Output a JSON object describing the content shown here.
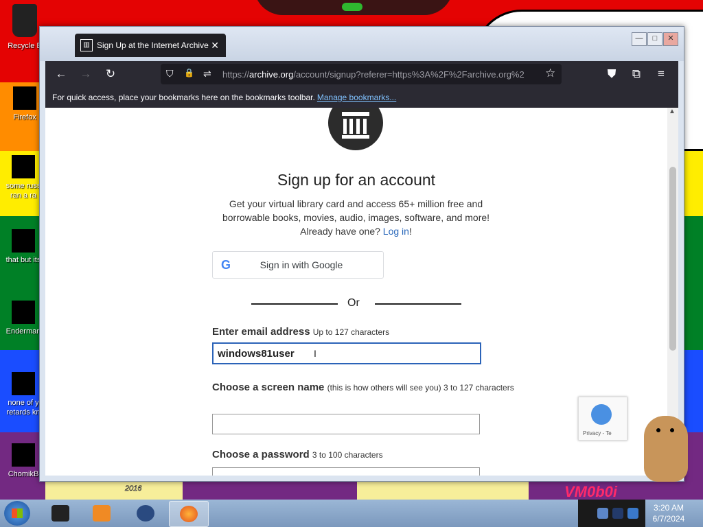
{
  "desktop": {
    "icons": [
      {
        "label": "Recycle B"
      },
      {
        "label": "Firefox"
      },
      {
        "label": "some russ ran a ra"
      },
      {
        "label": "that but its"
      },
      {
        "label": "Enderman"
      },
      {
        "label": "none of y retards kn"
      },
      {
        "label": "ChomikB"
      }
    ],
    "wallpaper_texts": {
      "tag": "2016",
      "sign": "VM0b0i"
    }
  },
  "browser": {
    "tab": {
      "title": "Sign Up at the Internet Archive",
      "close": "✕"
    },
    "url": {
      "prefix": "https://",
      "domain": "archive.org",
      "path": "/account/signup?referer=https%3A%2F%2Farchive.org%2"
    },
    "bookmarks_bar": {
      "text": "For quick access, place your bookmarks here on the bookmarks toolbar.",
      "link": "Manage bookmarks..."
    },
    "window_controls": {
      "minimize": "—",
      "maximize": "□",
      "close": "✕"
    },
    "icons": {
      "back": "←",
      "forward": "→",
      "reload": "↻",
      "shield": "⛉",
      "lock": "🔒",
      "star": "☆",
      "pocket": "⛊",
      "extensions": "⧉",
      "menu": "≡"
    }
  },
  "page": {
    "heading": "Sign up for an account",
    "intro_line1": "Get your virtual library card and access 65+ million free and borrowable books, movies, audio, images, software, and more!",
    "intro_line2": "Already have one?",
    "login_link": "Log in",
    "login_suffix": "!",
    "google_button": {
      "icon": "G",
      "label": "Sign in with Google"
    },
    "divider": "Or",
    "email": {
      "label": "Enter email address",
      "hint": "Up to 127 characters",
      "value": "windows81user"
    },
    "screen_name": {
      "label": "Choose a screen name",
      "hint": "(this is how others will see you) 3 to 127 characters",
      "value": ""
    },
    "password": {
      "label": "Choose a password",
      "hint": "3 to 100 characters",
      "value": ""
    },
    "recaptcha": {
      "text": "Privacy - Te"
    }
  },
  "taskbar": {
    "clock": {
      "time": "3:20 AM",
      "date": "6/7/2024"
    }
  }
}
